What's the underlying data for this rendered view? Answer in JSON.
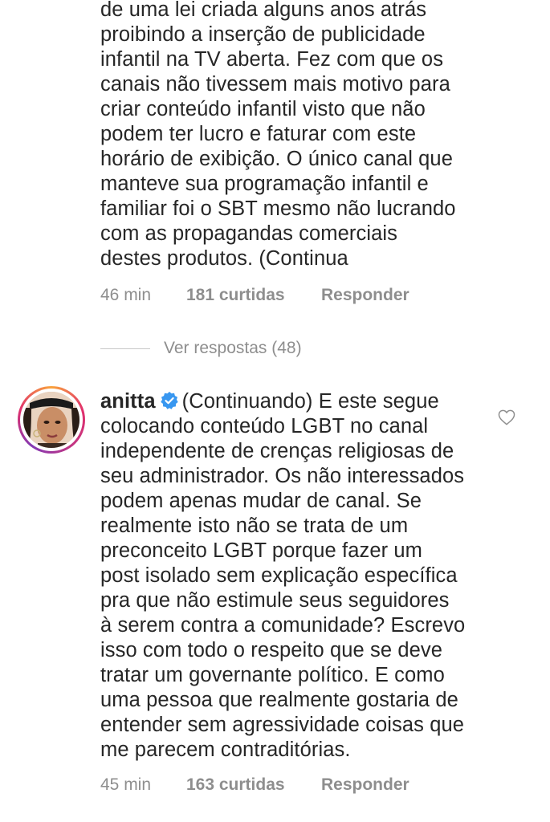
{
  "comment_1": {
    "text": "de uma lei criada alguns anos atrás\nproibindo a inserção de publicidade\ninfantil na TV aberta. Fez com que os\ncanais não tivessem mais motivo para\ncriar conteúdo infantil visto que não\npodem ter lucro e faturar com este\nhorário de exibição. O único canal que\nmanteve sua programação infantil e\nfamiliar foi o SBT mesmo não lucrando\ncom as propagandas comerciais\ndestes produtos. (Continua",
    "time": "46 min",
    "likes": "181 curtidas",
    "reply_label": "Responder"
  },
  "view_replies_label": "Ver respostas (48)",
  "comment_2": {
    "username": "anitta",
    "text": "(Continuando) E este segue\ncolocando conteúdo LGBT no canal\nindependente de crenças religiosas de\nseu administrador. Os não interessados\npodem apenas mudar de canal. Se\nrealmente isto não se trata de um\npreconceito LGBT porque fazer um\npost isolado sem explicação específica\npra que não estimule seus seguidores\nà serem contra a comunidade? Escrevo\nisso com todo o respeito que se deve\ntratar um governante político. E como\numa pessoa que realmente gostaria de\nentender sem agressividade coisas que\nme parecem contraditórias.",
    "time": "45 min",
    "likes": "163 curtidas",
    "reply_label": "Responder"
  },
  "colors": {
    "text": "#262626",
    "meta": "#8e8e8e",
    "verified": "#3897f0"
  },
  "icons": {
    "verified": "verified-badge-icon",
    "like": "heart-outline-icon",
    "avatar": "user-avatar"
  }
}
